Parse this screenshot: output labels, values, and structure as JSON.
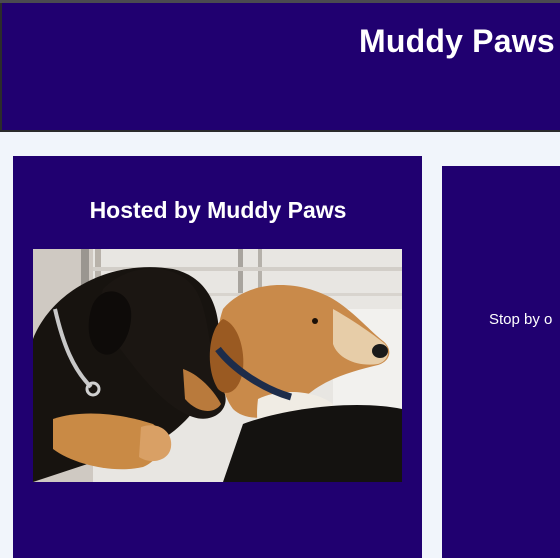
{
  "header": {
    "site_title": "Muddy Paws"
  },
  "left_card": {
    "title": "Hosted by Muddy Paws",
    "photo_alt": "Two dogs cuddling"
  },
  "right_card": {
    "text": "Stop by o"
  },
  "colors": {
    "brand_purple": "#200070",
    "page_background": "#f1f5fb",
    "text": "#ffffff"
  }
}
